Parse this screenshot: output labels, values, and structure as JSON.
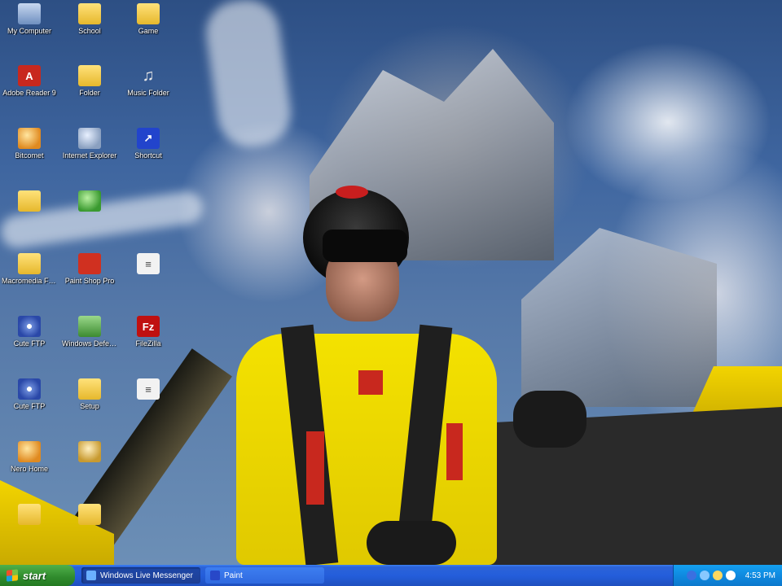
{
  "desktop": {
    "icons": [
      {
        "label": "My Computer",
        "icon": "computer-icon",
        "glyph": ""
      },
      {
        "label": "Adobe Reader 9",
        "icon": "adobe-reader-icon",
        "glyph": "A"
      },
      {
        "label": "Bitcomet",
        "icon": "bitcomet-icon",
        "glyph": ""
      },
      {
        "label": "",
        "icon": "folder-icon",
        "glyph": ""
      },
      {
        "label": "Macromedia Flash Player",
        "icon": "folder-icon",
        "glyph": ""
      },
      {
        "label": "Cute FTP",
        "icon": "cuteftp-icon",
        "glyph": ""
      },
      {
        "label": "Cute FTP",
        "icon": "cuteftp-icon",
        "glyph": ""
      },
      {
        "label": "Nero Home",
        "icon": "nero-icon",
        "glyph": ""
      },
      {
        "label": "",
        "icon": "folder-icon",
        "glyph": ""
      },
      {
        "label": "School",
        "icon": "folder-icon",
        "glyph": ""
      },
      {
        "label": "Folder",
        "icon": "folder-icon",
        "glyph": ""
      },
      {
        "label": "Internet Explorer",
        "icon": "globe-icon",
        "glyph": ""
      },
      {
        "label": "",
        "icon": "green-app-icon",
        "glyph": ""
      },
      {
        "label": "Paint Shop Pro",
        "icon": "paintshop-icon",
        "glyph": ""
      },
      {
        "label": "Windows Defender",
        "icon": "shield-icon",
        "glyph": ""
      },
      {
        "label": "Setup",
        "icon": "folder-icon",
        "glyph": ""
      },
      {
        "label": "",
        "icon": "person-icon",
        "glyph": ""
      },
      {
        "label": "",
        "icon": "folder-icon",
        "glyph": ""
      },
      {
        "label": "Game",
        "icon": "folder-icon",
        "glyph": ""
      },
      {
        "label": "Music Folder",
        "icon": "music-icon",
        "glyph": "♫"
      },
      {
        "label": "Shortcut",
        "icon": "shortcut-icon",
        "glyph": "↗"
      },
      {
        "label": "",
        "icon": "document-icon",
        "glyph": "≡"
      },
      {
        "label": "FileZilla",
        "icon": "filezilla-icon",
        "glyph": "Fz"
      },
      {
        "label": "",
        "icon": "document-icon",
        "glyph": "≡"
      }
    ]
  },
  "taskbar": {
    "start_label": "start",
    "tasks": [
      {
        "label": "Windows Live Messenger",
        "icon": "messenger-icon",
        "active": true
      },
      {
        "label": "Paint",
        "icon": "paint-icon",
        "active": false
      }
    ],
    "clock": "4:53 PM"
  },
  "colors": {
    "taskbar_blue": "#245edb",
    "start_green": "#2f8a2c",
    "tray_blue": "#0f8ae0"
  }
}
